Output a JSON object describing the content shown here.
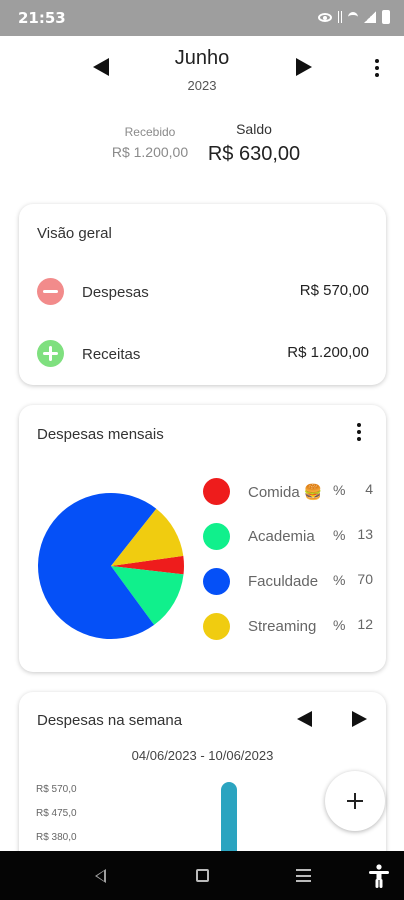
{
  "status_bar": {
    "time": "21:53",
    "icons": [
      "eye-icon",
      "vibrate-icon",
      "wifi-icon",
      "signal-icon",
      "battery-icon"
    ]
  },
  "header": {
    "month": "Junho",
    "year": "2023",
    "prev_icon": "triangle-left-icon",
    "next_icon": "triangle-right-icon",
    "menu_icon": "more-vert-icon"
  },
  "summary": {
    "recebido_label": "Recebido",
    "recebido_value": "R$ 1.200,00",
    "saldo_label": "Saldo",
    "saldo_value": "R$ 630,00"
  },
  "overview": {
    "title": "Visão geral",
    "items": [
      {
        "label": "Despesas",
        "value": "R$ 570,00",
        "icon": "minus-circle-icon",
        "color": "#f28b8b"
      },
      {
        "label": "Receitas",
        "value": "R$ 1.200,00",
        "icon": "plus-circle-icon",
        "color": "#7fe07f"
      }
    ]
  },
  "monthly": {
    "title": "Despesas mensais",
    "pct_symbol": "%",
    "categories": [
      {
        "name": "Comida 🍔",
        "percent": "4",
        "color": "#ee1c1c"
      },
      {
        "name": "Academia",
        "percent": "13",
        "color": "#10f08c"
      },
      {
        "name": "Faculdade",
        "percent": "70",
        "color": "#0550f7"
      },
      {
        "name": "Streaming",
        "percent": "12",
        "color": "#f0cc10"
      }
    ]
  },
  "weekly": {
    "title": "Despesas na semana",
    "range": "04/06/2023 - 10/06/2023",
    "y_ticks": [
      "R$ 570,0",
      "R$ 475,0",
      "R$ 380,0"
    ],
    "bar_color": "#2ba4c0"
  },
  "fab": {
    "icon": "plus-icon"
  },
  "nav_bar": {
    "icons": [
      "back-icon",
      "home-icon",
      "recents-icon",
      "accessibility-icon"
    ]
  },
  "chart_data": {
    "type": "pie",
    "title": "Despesas mensais",
    "categories": [
      "Comida 🍔",
      "Academia",
      "Faculdade",
      "Streaming"
    ],
    "values": [
      4,
      13,
      70,
      12
    ],
    "colors": [
      "#ee1c1c",
      "#10f08c",
      "#0550f7",
      "#f0cc10"
    ],
    "legend": "right"
  }
}
